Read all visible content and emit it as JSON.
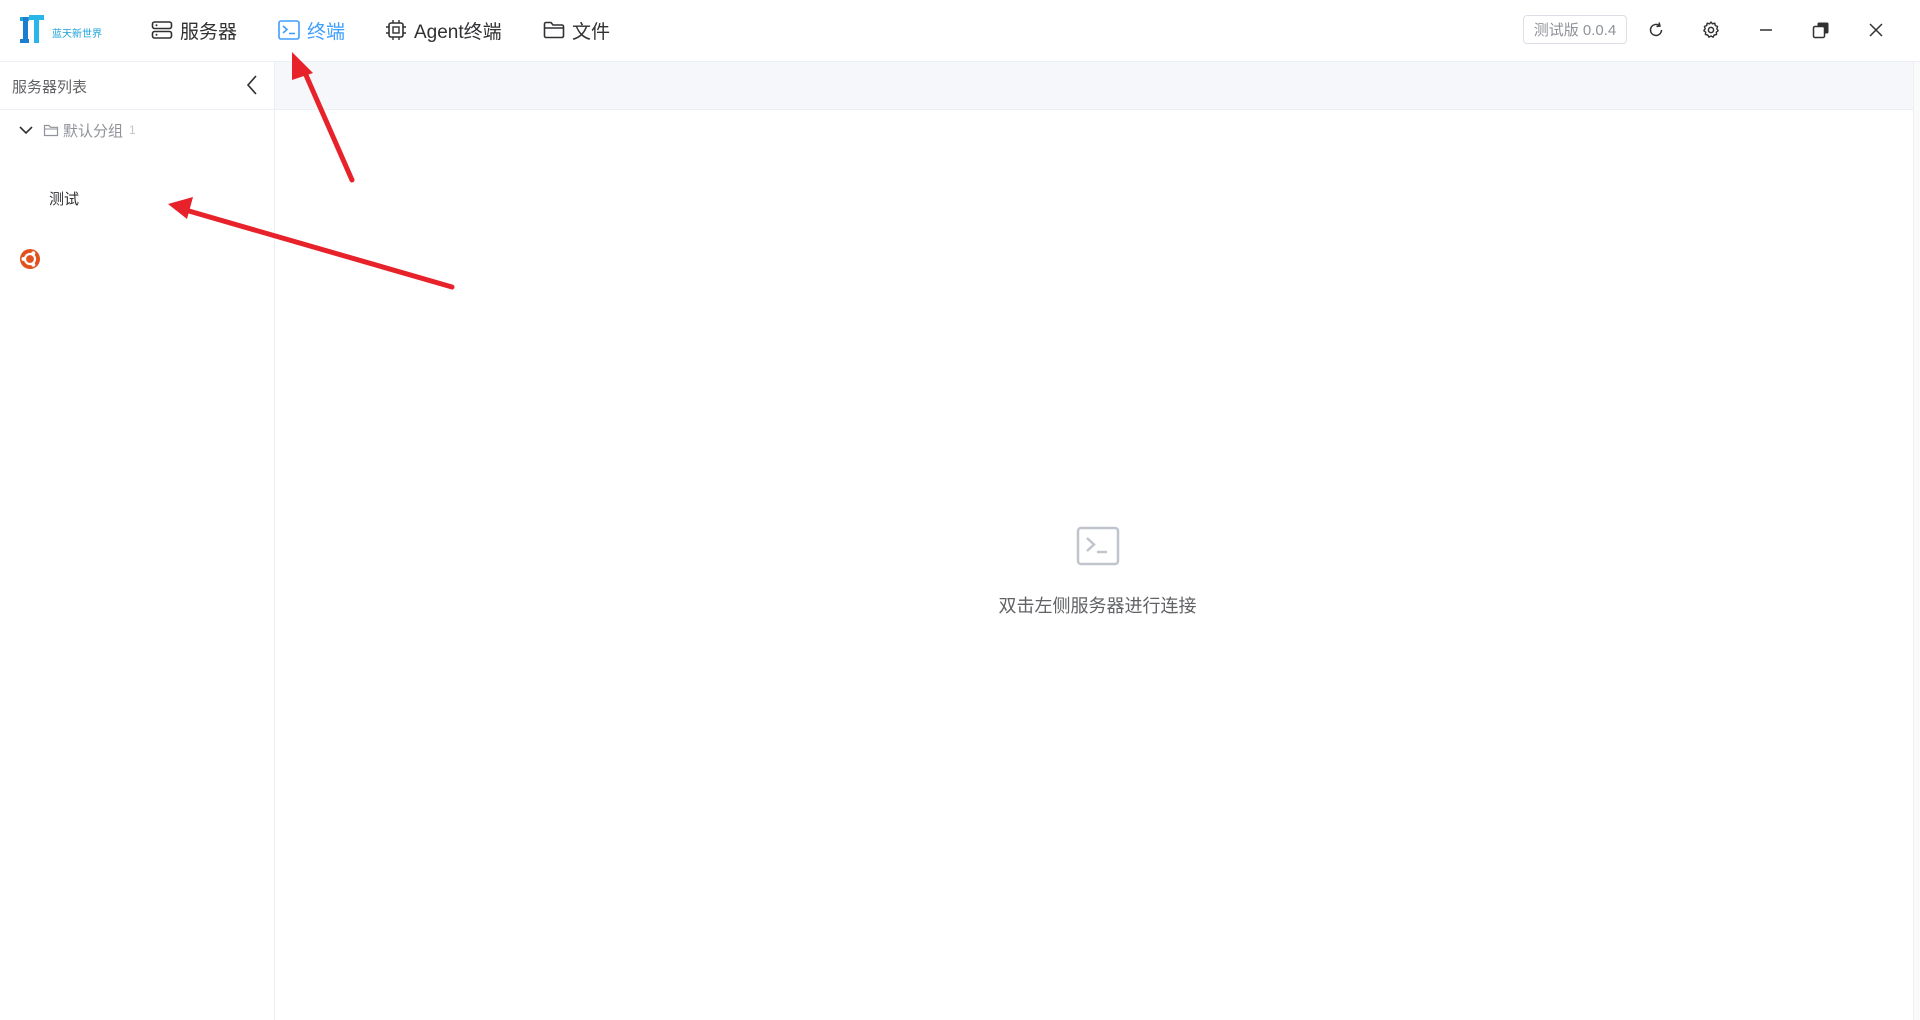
{
  "header": {
    "logo_text": "蓝天新世界",
    "nav": [
      {
        "label": "服务器",
        "icon": "server-icon",
        "active": false
      },
      {
        "label": "终端",
        "icon": "terminal-icon",
        "active": true
      },
      {
        "label": "Agent终端",
        "icon": "chip-icon",
        "active": false
      },
      {
        "label": "文件",
        "icon": "folder-icon",
        "active": false
      }
    ],
    "version": "测试版 0.0.4",
    "controls": [
      "refresh-icon",
      "gear-icon",
      "minimize-icon",
      "restore-icon",
      "close-icon"
    ]
  },
  "sidebar": {
    "title": "服务器列表",
    "group": {
      "name": "默认分组",
      "count": "1"
    },
    "servers": [
      {
        "name": "测试",
        "icon": "ubuntu-icon"
      }
    ]
  },
  "main": {
    "empty_icon": "terminal-icon",
    "empty_text": "双击左侧服务器进行连接"
  },
  "colors": {
    "accent": "#409eff",
    "annotation": "#e8222a",
    "ubuntu": "#e2511d"
  }
}
